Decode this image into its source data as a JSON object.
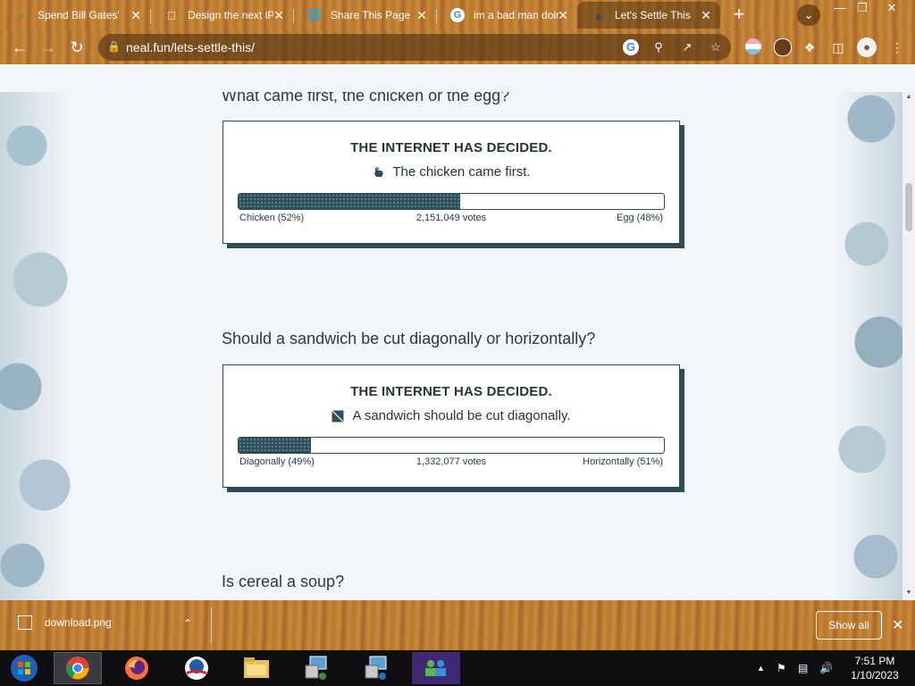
{
  "tabs": [
    {
      "title": "Spend Bill Gates'",
      "icon": "money-icon"
    },
    {
      "title": "Design the next iP",
      "icon": "apple-icon"
    },
    {
      "title": "Share This Page",
      "icon": "globe-icon"
    },
    {
      "title": "im a bad man doing",
      "icon": "google-icon"
    },
    {
      "title": "Let's Settle This",
      "icon": "chicken-icon"
    }
  ],
  "address": {
    "url": "neal.fun/lets-settle-this/"
  },
  "questions": [
    {
      "question": "What came first, the chicken or the egg?",
      "decided": "THE INTERNET HAS DECIDED.",
      "verdict": "The chicken came first.",
      "left_label": "Chicken (52%)",
      "votes": "2,151,049 votes",
      "right_label": "Egg (48%)",
      "left_share": 0.52
    },
    {
      "question": "Should a sandwich be cut diagonally or horizontally?",
      "decided": "THE INTERNET HAS DECIDED.",
      "verdict": "A sandwich should be cut diagonally.",
      "left_label": "Diagonally (49%)",
      "votes": "1,332,077 votes",
      "right_label": "Horizontally (51%)",
      "left_share": 0.17
    },
    {
      "question": "Is cereal a soup?"
    }
  ],
  "downloads": {
    "file": "download.png",
    "show_all": "Show all"
  },
  "clock": {
    "time": "7:51 PM",
    "date": "1/10/2023"
  },
  "colors": {
    "accent": "#2c4f5a",
    "chrome": "#b9762c"
  }
}
